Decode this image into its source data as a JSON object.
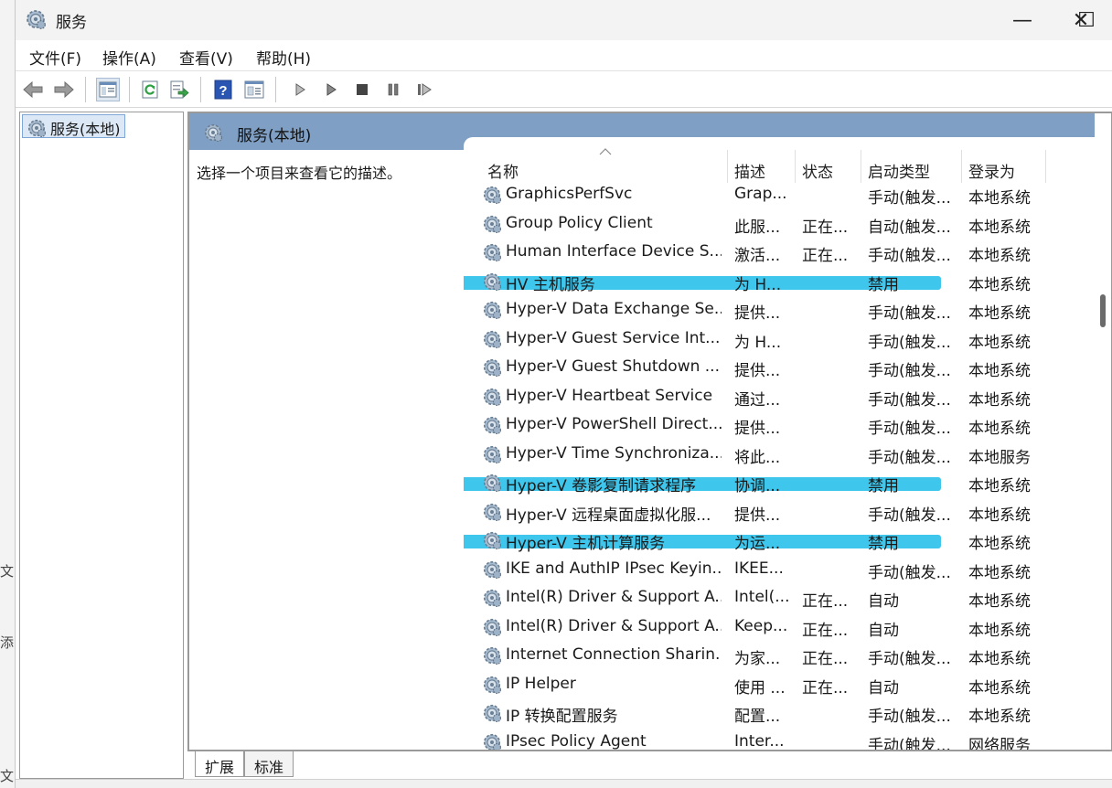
{
  "background_fragments": [
    "文",
    "添",
    "文"
  ],
  "window": {
    "title": "服务",
    "minimize_glyph": "—",
    "maximize_glyph": "☐",
    "close_glyph": "✕"
  },
  "menu": [
    "文件(F)",
    "操作(A)",
    "查看(V)",
    "帮助(H)"
  ],
  "toolbar_icons": [
    "back-icon",
    "forward-icon",
    "show-hide-console-tree-icon",
    "refresh-icon",
    "export-list-icon",
    "help-icon",
    "properties-icon",
    "start-service-icon",
    "start-service-alt-icon",
    "stop-service-icon",
    "pause-service-icon",
    "resume-service-icon"
  ],
  "tree": {
    "root_label": "服务(本地)"
  },
  "pane": {
    "header": "服务(本地)",
    "description_prompt": "选择一个项目来查看它的描述。"
  },
  "columns": [
    "名称",
    "描述",
    "状态",
    "启动类型",
    "登录为"
  ],
  "sort_indicator": "^",
  "rows": [
    {
      "name": "GraphicsPerfSvc",
      "desc": "Grap...",
      "status": "",
      "startup": "手动(触发...",
      "logon": "本地系统",
      "highlighted": false
    },
    {
      "name": "Group Policy Client",
      "desc": "此服...",
      "status": "正在...",
      "startup": "自动(触发...",
      "logon": "本地系统",
      "highlighted": false
    },
    {
      "name": "Human Interface Device S...",
      "desc": "激活...",
      "status": "正在...",
      "startup": "手动(触发...",
      "logon": "本地系统",
      "highlighted": false
    },
    {
      "name": "HV 主机服务",
      "desc": "为 H...",
      "status": "",
      "startup": "禁用",
      "logon": "本地系统",
      "highlighted": true
    },
    {
      "name": "Hyper-V Data Exchange Se...",
      "desc": "提供...",
      "status": "",
      "startup": "手动(触发...",
      "logon": "本地系统",
      "highlighted": false
    },
    {
      "name": "Hyper-V Guest Service Int...",
      "desc": "为 H...",
      "status": "",
      "startup": "手动(触发...",
      "logon": "本地系统",
      "highlighted": false
    },
    {
      "name": "Hyper-V Guest Shutdown ...",
      "desc": "提供...",
      "status": "",
      "startup": "手动(触发...",
      "logon": "本地系统",
      "highlighted": false
    },
    {
      "name": "Hyper-V Heartbeat Service",
      "desc": "通过...",
      "status": "",
      "startup": "手动(触发...",
      "logon": "本地系统",
      "highlighted": false
    },
    {
      "name": "Hyper-V PowerShell Direct...",
      "desc": "提供...",
      "status": "",
      "startup": "手动(触发...",
      "logon": "本地系统",
      "highlighted": false
    },
    {
      "name": "Hyper-V Time Synchroniza...",
      "desc": "将此...",
      "status": "",
      "startup": "手动(触发...",
      "logon": "本地服务",
      "highlighted": false
    },
    {
      "name": "Hyper-V 卷影复制请求程序",
      "desc": "协调...",
      "status": "",
      "startup": "禁用",
      "logon": "本地系统",
      "highlighted": true
    },
    {
      "name": "Hyper-V 远程桌面虚拟化服...",
      "desc": "提供...",
      "status": "",
      "startup": "手动(触发...",
      "logon": "本地系统",
      "highlighted": false
    },
    {
      "name": "Hyper-V 主机计算服务",
      "desc": "为运...",
      "status": "",
      "startup": "禁用",
      "logon": "本地系统",
      "highlighted": true
    },
    {
      "name": "IKE and AuthIP IPsec Keyin...",
      "desc": "IKEE...",
      "status": "",
      "startup": "手动(触发...",
      "logon": "本地系统",
      "highlighted": false
    },
    {
      "name": "Intel(R) Driver & Support A...",
      "desc": "Intel(...",
      "status": "正在...",
      "startup": "自动",
      "logon": "本地系统",
      "highlighted": false
    },
    {
      "name": "Intel(R) Driver & Support A...",
      "desc": "Keep...",
      "status": "正在...",
      "startup": "自动",
      "logon": "本地系统",
      "highlighted": false
    },
    {
      "name": "Internet Connection Sharin...",
      "desc": "为家...",
      "status": "正在...",
      "startup": "手动(触发...",
      "logon": "本地系统",
      "highlighted": false
    },
    {
      "name": "IP Helper",
      "desc": "使用 ...",
      "status": "正在...",
      "startup": "自动",
      "logon": "本地系统",
      "highlighted": false
    },
    {
      "name": "IP 转换配置服务",
      "desc": "配置...",
      "status": "",
      "startup": "手动(触发...",
      "logon": "本地系统",
      "highlighted": false
    },
    {
      "name": "IPsec Policy Agent",
      "desc": "Inter...",
      "status": "",
      "startup": "手动(触发...",
      "logon": "网络服务",
      "highlighted": false
    }
  ],
  "tabs": [
    "扩展",
    "标准"
  ],
  "colors": {
    "pane_header": "#7f9fc4",
    "highlight_marker": "#3ec6ec",
    "tree_selection": "#dce8f5"
  }
}
